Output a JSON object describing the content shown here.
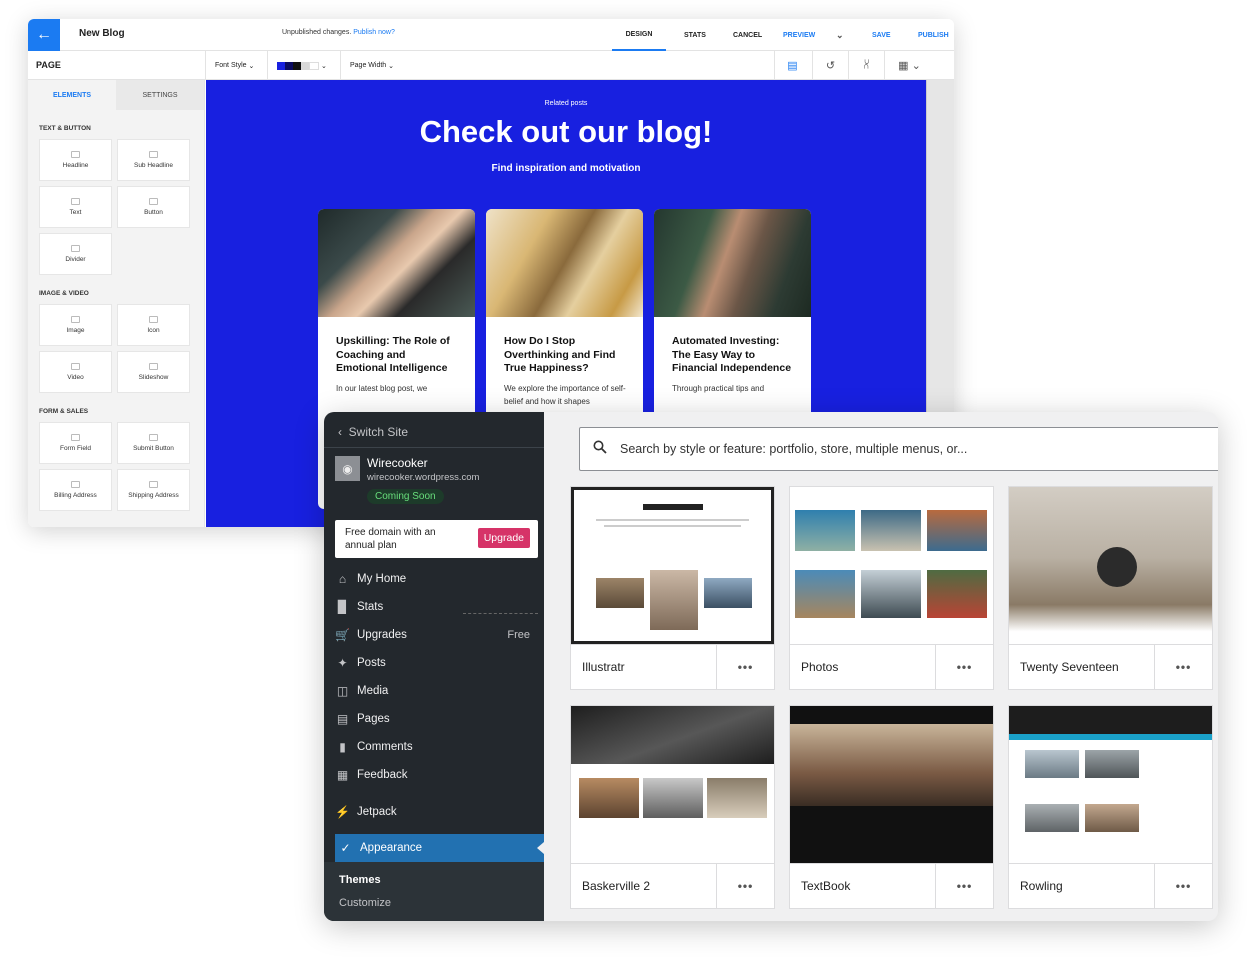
{
  "editor": {
    "back_icon": "arrow-left-icon",
    "title": "New Blog",
    "unpublished": "Unpublished changes.",
    "publish_now": "Publish now?",
    "nav": [
      "DESIGN",
      "STATS",
      "CANCEL",
      "PREVIEW",
      "SAVE",
      "PUBLISH"
    ],
    "page_label": "PAGE",
    "font_style": "Font Style",
    "page_width": "Page Width",
    "tabs": [
      "ELEMENTS",
      "SETTINGS"
    ],
    "sections": {
      "text_button": "TEXT & BUTTON",
      "image_video": "IMAGE & VIDEO",
      "form_sales": "FORM & SALES"
    },
    "elements": {
      "text_button": [
        "Headline",
        "Sub Headline",
        "Text",
        "Button",
        "Divider"
      ],
      "image_video": [
        "Image",
        "Icon",
        "Video",
        "Slideshow"
      ],
      "form_sales": [
        "Form Field",
        "Submit Button",
        "Billing Address",
        "Shipping Address"
      ]
    },
    "canvas": {
      "related": "Related posts",
      "heading": "Check out our blog!",
      "subheading": "Find inspiration and motivation",
      "posts": [
        {
          "title": "Upskilling: The Role of Coaching and Emotional Intelligence",
          "excerpt": "In our latest blog post, we"
        },
        {
          "title": "How Do I Stop Overthinking and Find True Happiness?",
          "excerpt": "We explore the importance of self-belief and how it shapes"
        },
        {
          "title": "Automated Investing: The Easy Way to Financial Independence",
          "excerpt": "Through practical tips and"
        }
      ]
    },
    "colors": {
      "accent": "#1b7bf2",
      "canvas": "#1820e0"
    }
  },
  "wp": {
    "switch_site": "Switch Site",
    "site_name": "Wirecooker",
    "site_url": "wirecooker.wordpress.com",
    "coming_soon": "Coming Soon",
    "plan_text": "Free domain with an annual plan",
    "upgrade": "Upgrade",
    "menu": [
      {
        "label": "My Home",
        "icon": "home-icon"
      },
      {
        "label": "Stats",
        "icon": "stats-icon"
      },
      {
        "label": "Upgrades",
        "icon": "cart-icon",
        "badge": "Free"
      },
      {
        "label": "Posts",
        "icon": "pin-icon"
      },
      {
        "label": "Media",
        "icon": "media-icon"
      },
      {
        "label": "Pages",
        "icon": "pages-icon"
      },
      {
        "label": "Comments",
        "icon": "comments-icon"
      },
      {
        "label": "Feedback",
        "icon": "feedback-icon"
      },
      {
        "label": "Jetpack",
        "icon": "jetpack-icon"
      }
    ],
    "appearance": "Appearance",
    "submenu": [
      "Themes",
      "Customize"
    ],
    "search_placeholder": "Search by style or feature: portfolio, store, multiple menus, or...",
    "themes": [
      "Illustratr",
      "Photos",
      "Twenty Seventeen",
      "Baskerville 2",
      "TextBook",
      "Rowling"
    ],
    "more_label": "•••"
  }
}
